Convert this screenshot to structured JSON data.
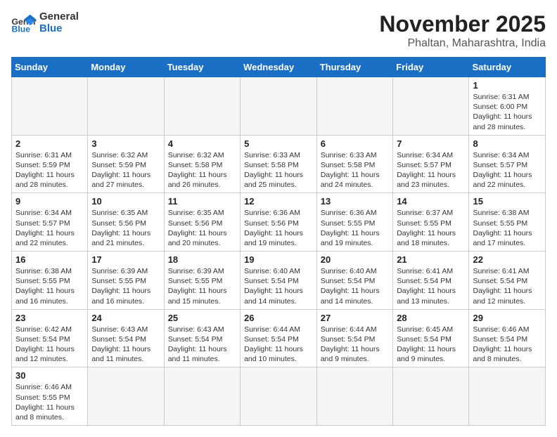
{
  "header": {
    "logo_general": "General",
    "logo_blue": "Blue",
    "month_title": "November 2025",
    "subtitle": "Phaltan, Maharashtra, India"
  },
  "weekdays": [
    "Sunday",
    "Monday",
    "Tuesday",
    "Wednesday",
    "Thursday",
    "Friday",
    "Saturday"
  ],
  "days": {
    "1": {
      "sunrise": "6:31 AM",
      "sunset": "6:00 PM",
      "daylight": "11 hours and 28 minutes."
    },
    "2": {
      "sunrise": "6:31 AM",
      "sunset": "5:59 PM",
      "daylight": "11 hours and 28 minutes."
    },
    "3": {
      "sunrise": "6:32 AM",
      "sunset": "5:59 PM",
      "daylight": "11 hours and 27 minutes."
    },
    "4": {
      "sunrise": "6:32 AM",
      "sunset": "5:58 PM",
      "daylight": "11 hours and 26 minutes."
    },
    "5": {
      "sunrise": "6:33 AM",
      "sunset": "5:58 PM",
      "daylight": "11 hours and 25 minutes."
    },
    "6": {
      "sunrise": "6:33 AM",
      "sunset": "5:58 PM",
      "daylight": "11 hours and 24 minutes."
    },
    "7": {
      "sunrise": "6:34 AM",
      "sunset": "5:57 PM",
      "daylight": "11 hours and 23 minutes."
    },
    "8": {
      "sunrise": "6:34 AM",
      "sunset": "5:57 PM",
      "daylight": "11 hours and 22 minutes."
    },
    "9": {
      "sunrise": "6:34 AM",
      "sunset": "5:57 PM",
      "daylight": "11 hours and 22 minutes."
    },
    "10": {
      "sunrise": "6:35 AM",
      "sunset": "5:56 PM",
      "daylight": "11 hours and 21 minutes."
    },
    "11": {
      "sunrise": "6:35 AM",
      "sunset": "5:56 PM",
      "daylight": "11 hours and 20 minutes."
    },
    "12": {
      "sunrise": "6:36 AM",
      "sunset": "5:56 PM",
      "daylight": "11 hours and 19 minutes."
    },
    "13": {
      "sunrise": "6:36 AM",
      "sunset": "5:55 PM",
      "daylight": "11 hours and 19 minutes."
    },
    "14": {
      "sunrise": "6:37 AM",
      "sunset": "5:55 PM",
      "daylight": "11 hours and 18 minutes."
    },
    "15": {
      "sunrise": "6:38 AM",
      "sunset": "5:55 PM",
      "daylight": "11 hours and 17 minutes."
    },
    "16": {
      "sunrise": "6:38 AM",
      "sunset": "5:55 PM",
      "daylight": "11 hours and 16 minutes."
    },
    "17": {
      "sunrise": "6:39 AM",
      "sunset": "5:55 PM",
      "daylight": "11 hours and 16 minutes."
    },
    "18": {
      "sunrise": "6:39 AM",
      "sunset": "5:55 PM",
      "daylight": "11 hours and 15 minutes."
    },
    "19": {
      "sunrise": "6:40 AM",
      "sunset": "5:54 PM",
      "daylight": "11 hours and 14 minutes."
    },
    "20": {
      "sunrise": "6:40 AM",
      "sunset": "5:54 PM",
      "daylight": "11 hours and 14 minutes."
    },
    "21": {
      "sunrise": "6:41 AM",
      "sunset": "5:54 PM",
      "daylight": "11 hours and 13 minutes."
    },
    "22": {
      "sunrise": "6:41 AM",
      "sunset": "5:54 PM",
      "daylight": "11 hours and 12 minutes."
    },
    "23": {
      "sunrise": "6:42 AM",
      "sunset": "5:54 PM",
      "daylight": "11 hours and 12 minutes."
    },
    "24": {
      "sunrise": "6:43 AM",
      "sunset": "5:54 PM",
      "daylight": "11 hours and 11 minutes."
    },
    "25": {
      "sunrise": "6:43 AM",
      "sunset": "5:54 PM",
      "daylight": "11 hours and 11 minutes."
    },
    "26": {
      "sunrise": "6:44 AM",
      "sunset": "5:54 PM",
      "daylight": "11 hours and 10 minutes."
    },
    "27": {
      "sunrise": "6:44 AM",
      "sunset": "5:54 PM",
      "daylight": "11 hours and 9 minutes."
    },
    "28": {
      "sunrise": "6:45 AM",
      "sunset": "5:54 PM",
      "daylight": "11 hours and 9 minutes."
    },
    "29": {
      "sunrise": "6:46 AM",
      "sunset": "5:54 PM",
      "daylight": "11 hours and 8 minutes."
    },
    "30": {
      "sunrise": "6:46 AM",
      "sunset": "5:55 PM",
      "daylight": "11 hours and 8 minutes."
    }
  }
}
